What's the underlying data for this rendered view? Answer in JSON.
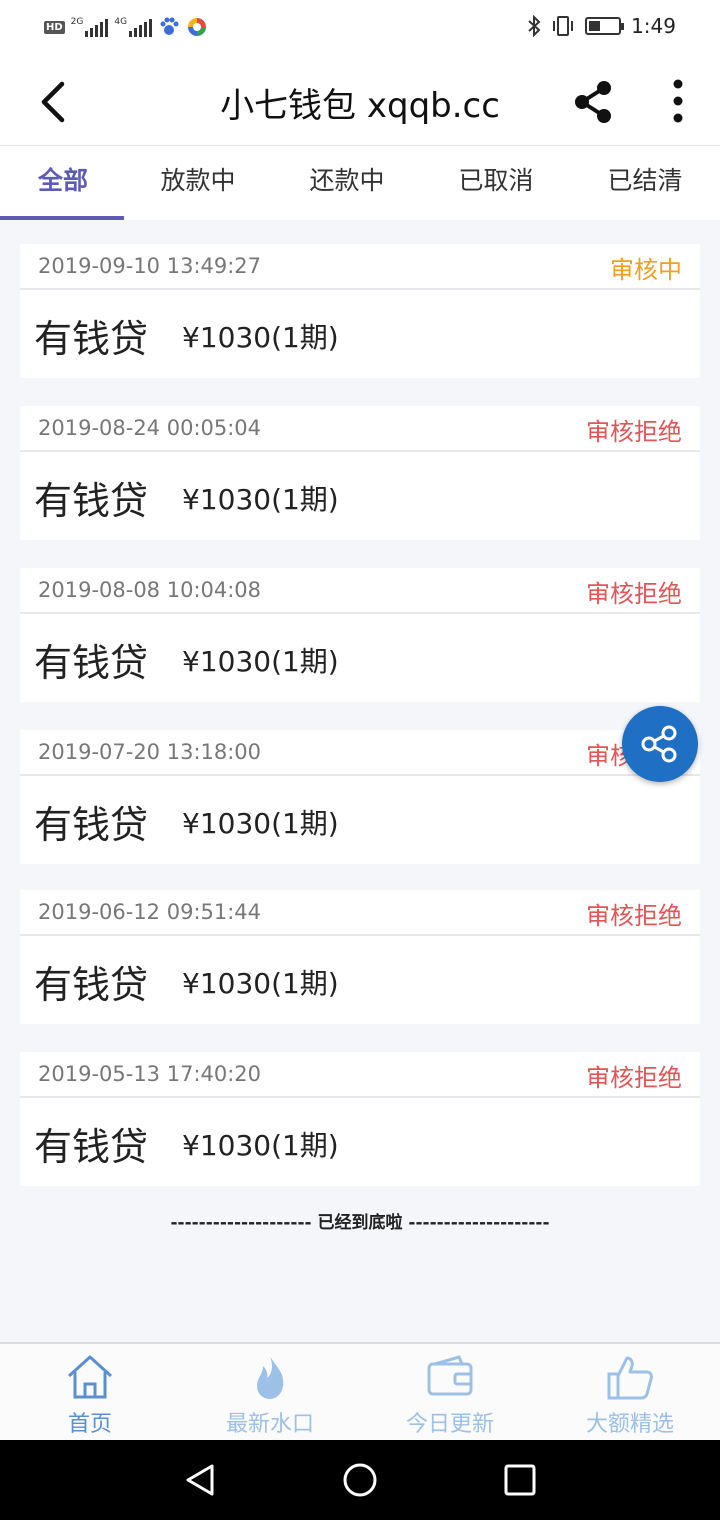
{
  "status_bar": {
    "hd": "HD",
    "sim1": "2G",
    "sim2": "4G",
    "time": "1:49"
  },
  "app_bar": {
    "title": "小七钱包 xqqb.cc",
    "back_icon": "chevron-left-icon",
    "share_icon": "share-icon",
    "more_icon": "more-vertical-icon"
  },
  "tabs": [
    {
      "label": "全部",
      "active": true
    },
    {
      "label": "放款中",
      "active": false
    },
    {
      "label": "还款中",
      "active": false
    },
    {
      "label": "已取消",
      "active": false
    },
    {
      "label": "已结清",
      "active": false
    }
  ],
  "orders": [
    {
      "date": "2019-09-10 13:49:27",
      "status": "审核中",
      "status_color": "#f0a020",
      "name": "有钱贷",
      "amount": "¥1030(1期)"
    },
    {
      "date": "2019-08-24 00:05:04",
      "status": "审核拒绝",
      "status_color": "#e25555",
      "name": "有钱贷",
      "amount": "¥1030(1期)"
    },
    {
      "date": "2019-08-08 10:04:08",
      "status": "审核拒绝",
      "status_color": "#e25555",
      "name": "有钱贷",
      "amount": "¥1030(1期)"
    },
    {
      "date": "2019-07-20 13:18:00",
      "status": "审核拒绝",
      "status_color": "#e25555",
      "name": "有钱贷",
      "amount": "¥1030(1期)"
    },
    {
      "date": "2019-06-12 09:51:44",
      "status": "审核拒绝",
      "status_color": "#e25555",
      "name": "有钱贷",
      "amount": "¥1030(1期)"
    },
    {
      "date": "2019-05-13 17:40:20",
      "status": "审核拒绝",
      "status_color": "#e25555",
      "name": "有钱贷",
      "amount": "¥1030(1期)"
    }
  ],
  "end_text": "-------------------- 已经到底啦 --------------------",
  "fab_icon": "share-icon",
  "bottom_nav": [
    {
      "label": "首页",
      "icon": "home-icon",
      "active": true
    },
    {
      "label": "最新水口",
      "icon": "flame-icon",
      "active": false
    },
    {
      "label": "今日更新",
      "icon": "wallet-icon",
      "active": false
    },
    {
      "label": "大额精选",
      "icon": "thumbs-up-icon",
      "active": false
    }
  ],
  "colors": {
    "accent": "#5e5bb8",
    "pending": "#f0a020",
    "rejected": "#e25555",
    "fab": "#1f6fc4",
    "nav_inactive": "#9cc0e6",
    "nav_active": "#5a8fd0"
  }
}
